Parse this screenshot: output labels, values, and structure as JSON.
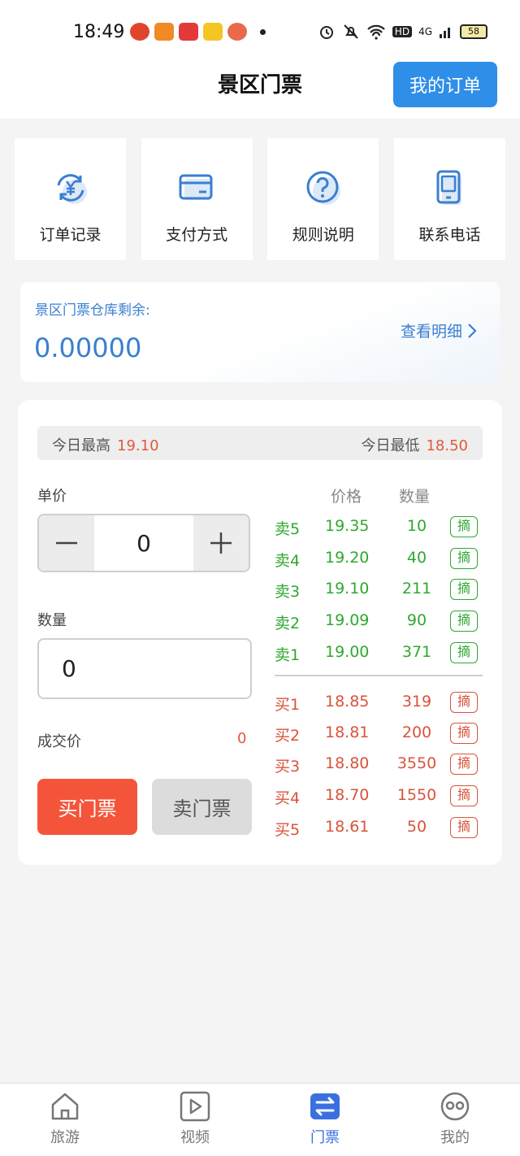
{
  "status_bar": {
    "time": "18:49",
    "network": "4G",
    "battery": "58",
    "hd": "HD"
  },
  "header": {
    "title": "景区门票",
    "orders_button": "我的订单"
  },
  "quick_menu": [
    {
      "label": "订单记录",
      "icon": "yen-refresh-icon"
    },
    {
      "label": "支付方式",
      "icon": "card-icon"
    },
    {
      "label": "规则说明",
      "icon": "question-icon"
    },
    {
      "label": "联系电话",
      "icon": "phone-icon"
    }
  ],
  "warehouse": {
    "label": "景区门票仓库剩余:",
    "value": "0.00000",
    "link": "查看明细"
  },
  "trade": {
    "today_high_label": "今日最高",
    "today_high": "19.10",
    "today_low_label": "今日最低",
    "today_low": "18.50",
    "unit_price_label": "单价",
    "unit_price_value": "0",
    "quantity_label": "数量",
    "quantity_value": "0",
    "deal_price_label": "成交价",
    "deal_price_value": "0",
    "buy_button": "买门票",
    "sell_button": "卖门票"
  },
  "order_book": {
    "price_header": "价格",
    "volume_header": "数量",
    "take_label": "摘",
    "asks": [
      {
        "side": "卖5",
        "price": "19.35",
        "volume": "10"
      },
      {
        "side": "卖4",
        "price": "19.20",
        "volume": "40"
      },
      {
        "side": "卖3",
        "price": "19.10",
        "volume": "211"
      },
      {
        "side": "卖2",
        "price": "19.09",
        "volume": "90"
      },
      {
        "side": "卖1",
        "price": "19.00",
        "volume": "371"
      }
    ],
    "bids": [
      {
        "side": "买1",
        "price": "18.85",
        "volume": "319"
      },
      {
        "side": "买2",
        "price": "18.81",
        "volume": "200"
      },
      {
        "side": "买3",
        "price": "18.80",
        "volume": "3550"
      },
      {
        "side": "买4",
        "price": "18.70",
        "volume": "1550"
      },
      {
        "side": "买5",
        "price": "18.61",
        "volume": "50"
      }
    ]
  },
  "bottom_nav": [
    {
      "label": "旅游",
      "icon": "home-icon",
      "active": false
    },
    {
      "label": "视频",
      "icon": "play-icon",
      "active": false
    },
    {
      "label": "门票",
      "icon": "exchange-icon",
      "active": true
    },
    {
      "label": "我的",
      "icon": "profile-icon",
      "active": false
    }
  ],
  "colors": {
    "accent_blue": "#2f8ee8",
    "buy_red": "#f4553a",
    "ask_green": "#2fa82f",
    "bid_red": "#d9533a"
  }
}
